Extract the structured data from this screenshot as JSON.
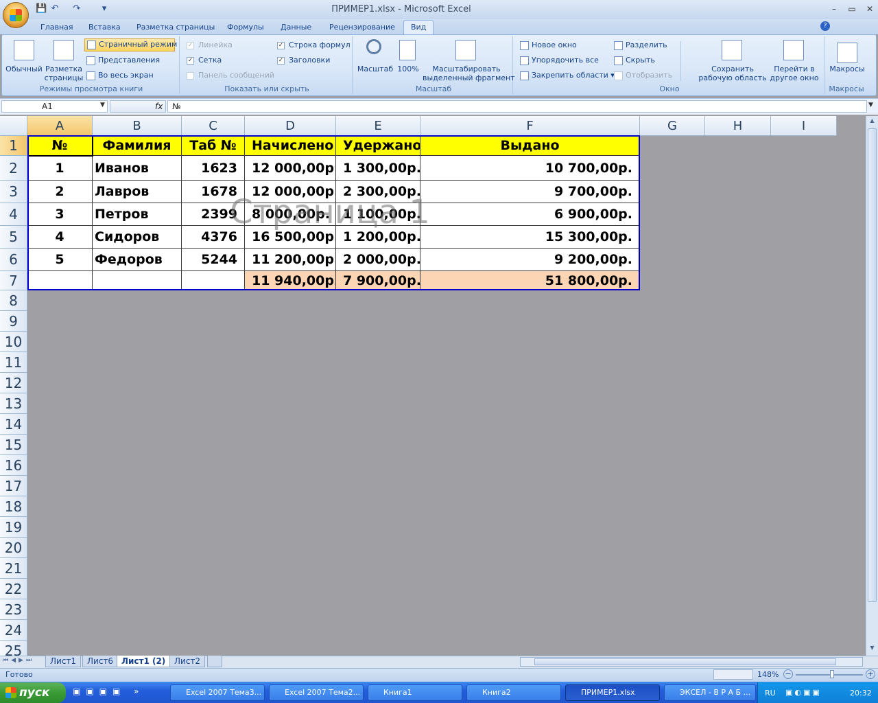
{
  "app": {
    "title": "ПРИМЕР1.xlsx - Microsoft Excel",
    "win_min": "–",
    "win_max": "▭",
    "win_close": "✕",
    "qat_save": "💾",
    "qat_undo": "↶",
    "qat_redo": "↷",
    "qat_more": "▾"
  },
  "ribbon_tabs": [
    {
      "label": "Главная"
    },
    {
      "label": "Вставка"
    },
    {
      "label": "Разметка страницы"
    },
    {
      "label": "Формулы"
    },
    {
      "label": "Данные"
    },
    {
      "label": "Рецензирование"
    },
    {
      "label": "Вид"
    }
  ],
  "ribbon": {
    "views": {
      "label": "Режимы просмотра книги",
      "normal": "Обычный",
      "page_layout": "Разметка\nстраницы",
      "page_break": "Страничный режим",
      "custom_views": "Представления",
      "full_screen": "Во весь экран"
    },
    "show_hide": {
      "label": "Показать или скрыть",
      "ruler": "Линейка",
      "gridlines": "Сетка",
      "message_bar": "Панель сообщений",
      "formula_bar": "Строка формул",
      "headings": "Заголовки"
    },
    "zoom": {
      "label": "Масштаб",
      "zoom": "Масштаб",
      "hundred": "100%",
      "zoom_selection": "Масштабировать\nвыделенный фрагмент"
    },
    "window": {
      "label": "Окно",
      "new_window": "Новое окно",
      "arrange_all": "Упорядочить все",
      "freeze_panes": "Закрепить области",
      "split": "Разделить",
      "hide": "Скрыть",
      "unhide": "Отобразить",
      "save_workspace": "Сохранить\nрабочую область",
      "switch_windows": "Перейти в\nдругое окно"
    },
    "macros": {
      "label": "Макросы",
      "macros": "Макросы"
    }
  },
  "formula_bar": {
    "name_box": "A1",
    "fx": "fx",
    "value": "№"
  },
  "columns": [
    "A",
    "B",
    "C",
    "D",
    "E",
    "F",
    "G",
    "H",
    "I"
  ],
  "rows": [
    "1",
    "2",
    "3",
    "4",
    "5",
    "6",
    "7",
    "8",
    "9",
    "10",
    "11",
    "12",
    "13",
    "14",
    "15",
    "16",
    "17",
    "18",
    "19",
    "20",
    "21",
    "22",
    "23",
    "24",
    "25"
  ],
  "sheet": {
    "headers": [
      "№",
      "Фамилия",
      "Таб №",
      "Начислено",
      "Удержано",
      "Выдано"
    ],
    "data": [
      [
        "1",
        "Иванов",
        "1623",
        "12 000,00р.",
        "1 300,00р.",
        "10 700,00р."
      ],
      [
        "2",
        "Лавров",
        "1678",
        "12 000,00р.",
        "2 300,00р.",
        "9 700,00р."
      ],
      [
        "3",
        "Петров",
        "2399",
        "8 000,00р.",
        "1 100,00р.",
        "6 900,00р."
      ],
      [
        "4",
        "Сидоров",
        "4376",
        "16 500,00р.",
        "1 200,00р.",
        "15 300,00р."
      ],
      [
        "5",
        "Федоров",
        "5244",
        "11 200,00р.",
        "2 000,00р.",
        "9 200,00р."
      ]
    ],
    "totals": [
      "",
      "",
      "",
      "11 940,00р.",
      "7 900,00р.",
      "51 800,00р."
    ],
    "page_watermark": "Страница 1",
    "colors": {
      "header_fill": "#ffff00",
      "total_fill": "#fcd5b4",
      "border": "#0000cc"
    }
  },
  "sheet_tabs": [
    {
      "label": "Лист1"
    },
    {
      "label": "Лист6"
    },
    {
      "label": "Лист1 (2)"
    },
    {
      "label": "Лист2"
    }
  ],
  "status": {
    "ready": "Готово",
    "zoom": "148%"
  },
  "taskbar": {
    "start": "пуск",
    "buttons": [
      {
        "label": "Excel 2007 Тема3..."
      },
      {
        "label": "Excel 2007 Тема2..."
      },
      {
        "label": "Книга1"
      },
      {
        "label": "Книга2"
      },
      {
        "label": "ПРИМЕР1.xlsx"
      },
      {
        "label": "ЭКСЕЛ - В Р А Б ..."
      }
    ],
    "lang": "RU",
    "clock": "20:32"
  }
}
